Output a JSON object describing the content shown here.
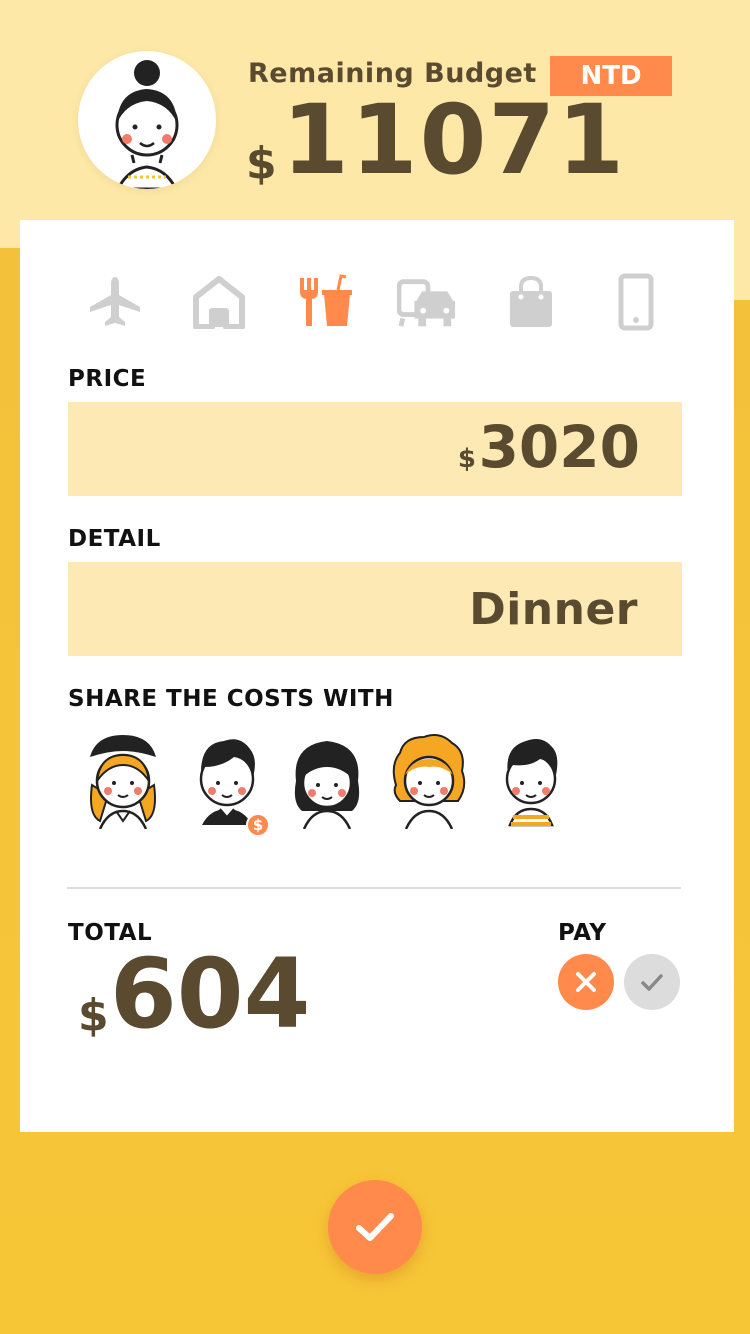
{
  "header": {
    "title": "Remaining Budget",
    "currency": "NTD",
    "budget_symbol": "$",
    "budget_value": "11071"
  },
  "categories": [
    {
      "icon": "airplane-icon",
      "active": false
    },
    {
      "icon": "home-icon",
      "active": false
    },
    {
      "icon": "food-drink-icon",
      "active": true
    },
    {
      "icon": "transport-icon",
      "active": false
    },
    {
      "icon": "shopping-bag-icon",
      "active": false
    },
    {
      "icon": "phone-icon",
      "active": false
    }
  ],
  "price": {
    "label": "PRICE",
    "symbol": "$",
    "value": "3020"
  },
  "detail": {
    "label": "DETAIL",
    "value": "Dinner"
  },
  "share": {
    "label": "SHARE THE COSTS WITH",
    "payer_badge": "$"
  },
  "total": {
    "label": "TOTAL",
    "symbol": "$",
    "value": "604"
  },
  "pay": {
    "label": "PAY"
  },
  "colors": {
    "accent": "#ff8a4c",
    "brown": "#5a4a30",
    "field_bg": "#fde9b3",
    "page_bg": "#f6c43a",
    "header_bg": "#fde8a8",
    "inactive_icon": "#cfcfcf"
  }
}
